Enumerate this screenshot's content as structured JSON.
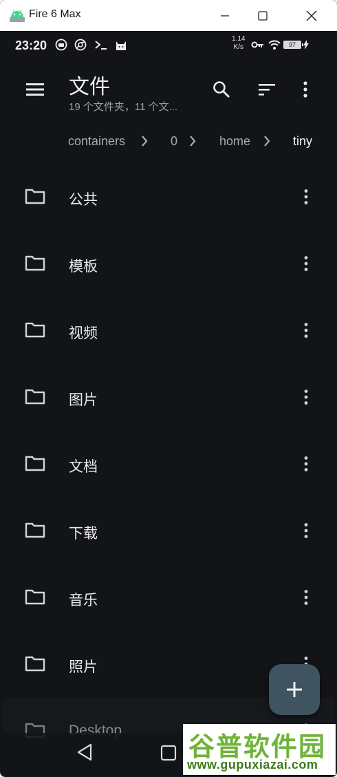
{
  "window": {
    "title": "Fire 6 Max",
    "minimize_icon": "minimize-icon",
    "maximize_icon": "maximize-icon",
    "close_icon": "close-icon"
  },
  "statusbar": {
    "time": "23:20",
    "speed_line1": "1.14",
    "speed_line2": "K/s",
    "battery": "97"
  },
  "appbar": {
    "title": "文件",
    "subtitle": "19 个文件夹，11 个文...",
    "icons": [
      "menu-icon",
      "search-icon",
      "sort-icon",
      "more-vert-icon"
    ]
  },
  "breadcrumb": [
    "containers",
    "0",
    "home",
    "tiny"
  ],
  "files": [
    {
      "name": "公共"
    },
    {
      "name": "模板"
    },
    {
      "name": "视频"
    },
    {
      "name": "图片"
    },
    {
      "name": "文档"
    },
    {
      "name": "下载"
    },
    {
      "name": "音乐"
    },
    {
      "name": "照片"
    },
    {
      "name": "Desktop"
    }
  ],
  "fab": {
    "icon": "plus-icon"
  },
  "watermark": {
    "title": "谷普软件园",
    "url": "www.gupuxiazai.com"
  },
  "colors": {
    "background": "#121417",
    "fab": "#3f5460",
    "text_primary": "#e8eaed",
    "text_secondary": "#9aa0a6",
    "watermark_green": "#6fb43a"
  }
}
